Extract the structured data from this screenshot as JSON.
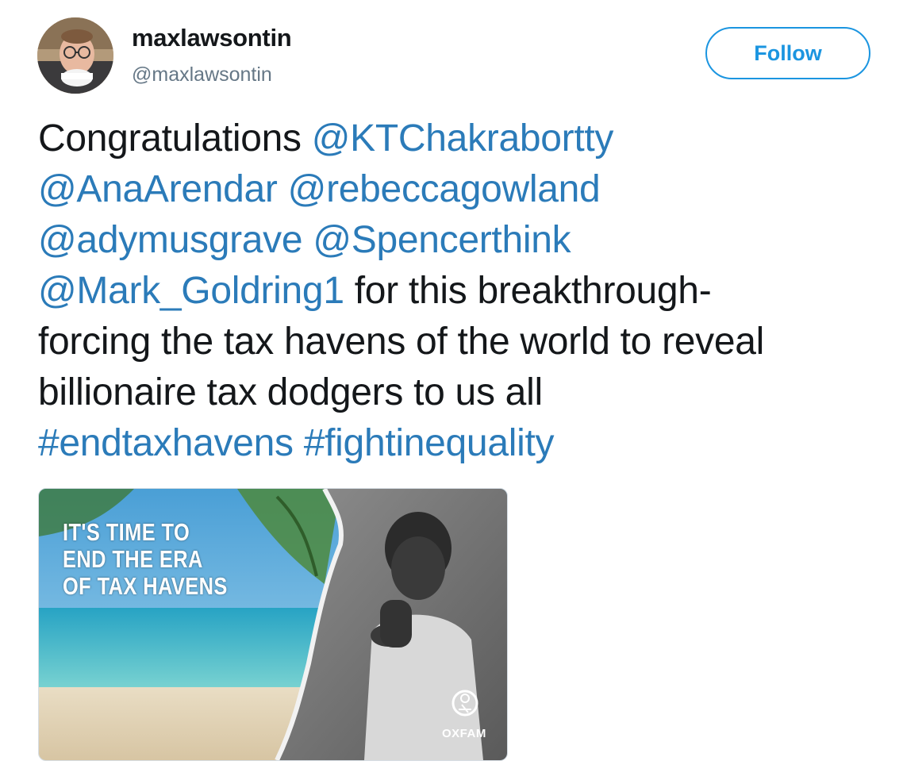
{
  "author": {
    "display_name": "maxlawsontin",
    "handle": "@maxlawsontin"
  },
  "follow_button": {
    "label": "Follow"
  },
  "tweet": {
    "lines": [
      [
        {
          "text": "Congratulations ",
          "type": "text"
        },
        {
          "text": "@KTChakrabortty",
          "type": "mention"
        }
      ],
      [
        {
          "text": "@AnaArendar",
          "type": "mention"
        },
        {
          "text": " ",
          "type": "text"
        },
        {
          "text": "@rebeccagowland",
          "type": "mention"
        }
      ],
      [
        {
          "text": "@adymusgrave",
          "type": "mention"
        },
        {
          "text": " ",
          "type": "text"
        },
        {
          "text": "@Spencerthink",
          "type": "mention"
        }
      ],
      [
        {
          "text": "@Mark_Goldring1",
          "type": "mention"
        },
        {
          "text": " for this breakthrough-",
          "type": "text"
        }
      ],
      [
        {
          "text": "forcing the tax havens of the world to reveal",
          "type": "text"
        }
      ],
      [
        {
          "text": "billionaire tax dodgers to us all",
          "type": "text"
        }
      ],
      [
        {
          "text": "#endtaxhavens",
          "type": "hashtag"
        },
        {
          "text": " ",
          "type": "text"
        },
        {
          "text": "#fightinequality",
          "type": "hashtag"
        }
      ]
    ]
  },
  "media": {
    "headline": [
      "IT'S TIME TO",
      "END THE ERA",
      "OF TAX HAVENS"
    ],
    "logo_text": "OXFAM"
  },
  "colors": {
    "link": "#2b7bb9",
    "follow_accent": "#1b95e0",
    "text": "#14171a",
    "secondary": "#657786"
  }
}
